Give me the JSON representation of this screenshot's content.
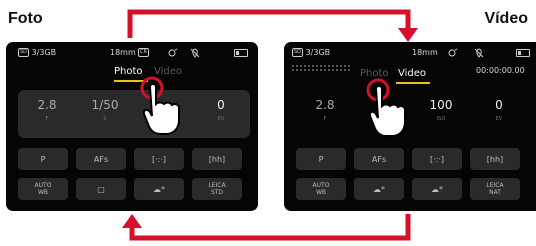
{
  "titles": {
    "left": "Foto",
    "right": "Vídeo"
  },
  "colors": {
    "arrow": "#d4102a",
    "highlight": "#e8c218"
  },
  "foto": {
    "status": {
      "sd": "SD",
      "storage": "3/3GB",
      "lens": "18mm",
      "cr": "CR"
    },
    "tabs": {
      "photo": "Photo",
      "video": "Video"
    },
    "exposure": [
      {
        "value": "2.8",
        "label": "F"
      },
      {
        "value": "1/50",
        "label": "S"
      },
      {
        "value": "",
        "label": ""
      },
      {
        "value": "0",
        "label": "EV"
      }
    ],
    "row1": [
      "P",
      "AFs",
      "[·:·]",
      "[hh]"
    ],
    "row2": [
      "AUTO\nWB",
      "▢",
      "☁*",
      "LEICA\nSTD"
    ]
  },
  "video": {
    "status": {
      "sd": "SD",
      "storage": "3/3GB",
      "lens": "18mm",
      "timecode": "00:00:00.00"
    },
    "tabs": {
      "photo": "Photo",
      "video": "Video"
    },
    "exposure": [
      {
        "value": "2.8",
        "label": "F"
      },
      {
        "value": "",
        "label": ""
      },
      {
        "value": "100",
        "label": "ISO"
      },
      {
        "value": "0",
        "label": "EV"
      }
    ],
    "row1": [
      "P",
      "AFs",
      "[·:·]",
      "[hh]"
    ],
    "row2": [
      "AUTO\nWB",
      "☁*",
      "☁*",
      "LEICA\nNAT"
    ]
  }
}
